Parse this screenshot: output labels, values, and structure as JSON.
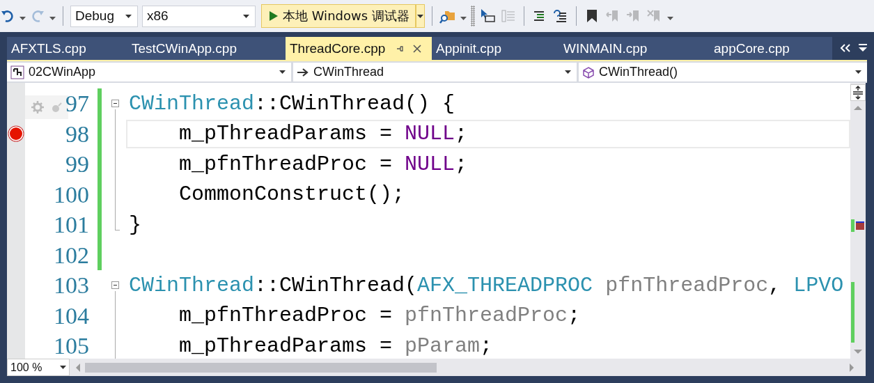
{
  "toolbar": {
    "tools_left": [
      {
        "kind": "undo",
        "disabled": false
      },
      {
        "kind": "redo",
        "disabled": true
      }
    ],
    "configuration": "Debug",
    "platform": "x86",
    "run_button": "本地 Windows 调试器",
    "tool_groups": [
      [
        {
          "kind": "find",
          "disabled": false
        }
      ],
      [
        {
          "kind": "cursor",
          "disabled": false
        },
        {
          "kind": "block",
          "disabled": true
        }
      ],
      [
        {
          "kind": "lines",
          "disabled": false
        },
        {
          "kind": "undo-lines",
          "disabled": false
        }
      ],
      [
        {
          "kind": "bookmark",
          "disabled": false
        },
        {
          "kind": "bm-prev",
          "disabled": true
        },
        {
          "kind": "bm-next",
          "disabled": true
        },
        {
          "kind": "bm-clear",
          "disabled": true
        }
      ]
    ]
  },
  "tabs": [
    {
      "label": "AFXTLS.cpp",
      "selected": false
    },
    {
      "label": "TestCWinApp.cpp",
      "selected": false
    },
    {
      "label": "ThreadCore.cpp",
      "selected": true
    },
    {
      "label": "Appinit.cpp",
      "selected": false
    },
    {
      "label": "WINMAIN.cpp",
      "selected": false
    },
    {
      "label": "appCore.cpp",
      "selected": false
    }
  ],
  "navigation": {
    "project": "02CWinApp",
    "scope": "CWinThread",
    "member": "CWinThread()"
  },
  "editor": {
    "lines": [
      {
        "number": "97",
        "breakpoint": false,
        "changed": true,
        "current": false,
        "tokens": [
          {
            "kind": "type",
            "text": "CWinThread"
          },
          {
            "kind": "plain",
            "text": "::CWinThread() {"
          }
        ],
        "children": [
          {
            "number": "98",
            "breakpoint": true,
            "changed": true,
            "current": true,
            "tokens": [
              {
                "kind": "plain",
                "text": "    m_pThreadParams = "
              },
              {
                "kind": "macro",
                "text": "NULL"
              },
              {
                "kind": "plain",
                "text": ";"
              }
            ]
          },
          {
            "number": "99",
            "breakpoint": false,
            "changed": true,
            "current": false,
            "tokens": [
              {
                "kind": "plain",
                "text": "    m_pfnThreadProc = "
              },
              {
                "kind": "macro",
                "text": "NULL"
              },
              {
                "kind": "plain",
                "text": ";"
              }
            ]
          },
          {
            "number": "100",
            "breakpoint": false,
            "changed": true,
            "current": false,
            "tokens": [
              {
                "kind": "plain",
                "text": "    CommonConstruct();"
              }
            ]
          },
          {
            "number": "101",
            "breakpoint": false,
            "changed": true,
            "current": false,
            "tokens": [
              {
                "kind": "plain",
                "text": "}"
              }
            ]
          }
        ]
      },
      {
        "number": "102",
        "breakpoint": false,
        "changed": true,
        "current": false
      },
      {
        "number": "103",
        "breakpoint": false,
        "changed": false,
        "current": false,
        "tokens": [
          {
            "kind": "type",
            "text": "CWinThread"
          },
          {
            "kind": "plain",
            "text": "::CWinThread("
          },
          {
            "kind": "type",
            "text": "AFX_THREADPROC"
          },
          {
            "kind": "param",
            "text": " pfnThreadProc"
          },
          {
            "kind": "plain",
            "text": ", "
          },
          {
            "kind": "type",
            "text": "LPVO"
          }
        ],
        "children": [
          {
            "number": "104",
            "breakpoint": false,
            "changed": false,
            "current": false,
            "tokens": [
              {
                "kind": "plain",
                "text": "    m_pfnThreadProc = "
              },
              {
                "kind": "param",
                "text": "pfnThreadProc"
              },
              {
                "kind": "plain",
                "text": ";"
              }
            ]
          },
          {
            "number": "105",
            "breakpoint": false,
            "changed": false,
            "current": false,
            "tokens": [
              {
                "kind": "plain",
                "text": "    m_pThreadParams = "
              },
              {
                "kind": "param",
                "text": "pParam"
              },
              {
                "kind": "plain",
                "text": ";"
              }
            ]
          }
        ]
      }
    ]
  },
  "zoom": "100 %"
}
